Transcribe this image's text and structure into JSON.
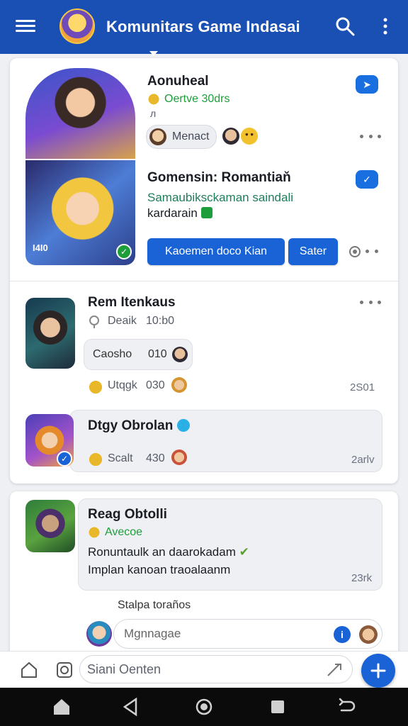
{
  "app": {
    "title": "Komunitars Game Indasai"
  },
  "post1": {
    "author": "Aonuheal",
    "badge": "Oertve 30drs",
    "meta": "л",
    "chip_label": "Menact",
    "heading": "Gomensin: Romantiaň",
    "text_line1": "Samaubiksckaman saindali",
    "text_line2": "kardarain ",
    "overlay_tag": "Ӏ4Ӏ0",
    "primary_button": "Kaoemen doco Kian",
    "secondary_button": "Sater"
  },
  "comment1": {
    "author": "Rem Itenkaus",
    "status_label": "Deaik",
    "status_value": "10:b0",
    "reply_name": "Caosho",
    "reply_value": "010",
    "sub_label": "Utqgk",
    "sub_value": "030",
    "time": "2S01"
  },
  "comment2": {
    "author": "Dtgy Obrolan",
    "label": "Scalt",
    "value": "430",
    "time": "2arlv"
  },
  "post2": {
    "author": "Reag Obtolli",
    "badge": "Avecoe",
    "text_line1": "Ronuntaulk an daarokadam",
    "text_line2": "Implan kanoan traoalaanm",
    "time": "23rk",
    "reply_hint": "Stalpa toraños",
    "reply_placeholder": "Mgnnagae"
  },
  "composer": {
    "placeholder": "Siani Oenten"
  },
  "colors": {
    "appbar": "#1a4fb3",
    "accent": "#1a63d6",
    "green": "#1e9e3a"
  },
  "icons": [
    "menu-icon",
    "search-icon",
    "more-vert-icon",
    "send-icon",
    "image-icon",
    "home-icon",
    "back-icon",
    "recents-icon"
  ]
}
